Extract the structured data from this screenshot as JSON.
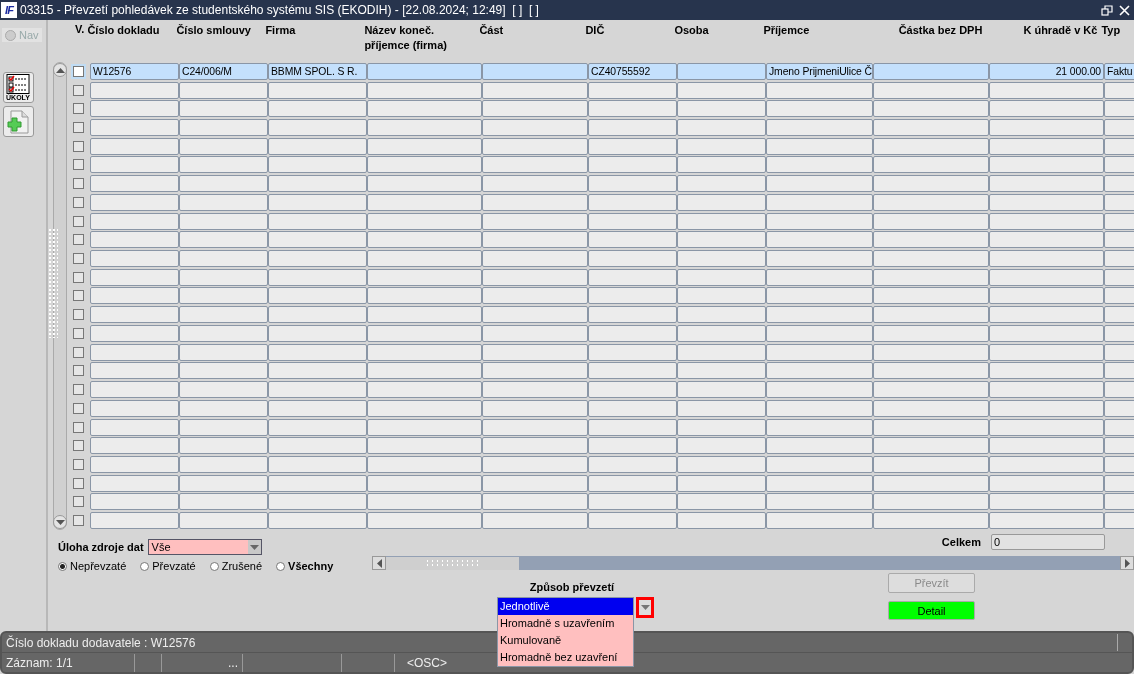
{
  "window": {
    "logo": "IF",
    "title": "03315 - Převzetí pohledávek ze studentského systému SIS (EKODIH) - [22.08.2024; 12:49]  [ ]  [ ]"
  },
  "sidebar": {
    "nav": {
      "label": "Nav",
      "disabled": true
    },
    "tools": [
      {
        "kind": "tasks",
        "label": "ÚKOLY"
      },
      {
        "kind": "add"
      }
    ]
  },
  "table": {
    "check_header": "V.",
    "columns": [
      {
        "label": "Číslo dokladu",
        "kind": "text"
      },
      {
        "label": "Číslo smlouvy",
        "kind": "text"
      },
      {
        "label": "Firma",
        "kind": "text"
      },
      {
        "label": "Název koneč. příjemce (firma)",
        "kind": "text"
      },
      {
        "label": "Část",
        "kind": "text"
      },
      {
        "label": "DIČ",
        "kind": "text"
      },
      {
        "label": "Osoba",
        "kind": "text"
      },
      {
        "label": "Příjemce",
        "kind": "text"
      },
      {
        "label": "Částka bez DPH",
        "kind": "amount"
      },
      {
        "label": "K úhradě v Kč",
        "kind": "amount"
      },
      {
        "label": "Typ",
        "kind": "text"
      }
    ],
    "rows": [
      {
        "selected": true,
        "checked": false,
        "cells": {
          "0": "W12576",
          "1": "C24/006/M",
          "2": "BBMM SPOL. S R.",
          "5": "CZ40755592",
          "7": "Jmeno PrijmeniUlice Č",
          "9": "21 000.00",
          "10": "Faktu"
        }
      },
      {
        "selected": false,
        "checked": false
      },
      {
        "selected": false,
        "checked": false
      },
      {
        "selected": false,
        "checked": false
      },
      {
        "selected": false,
        "checked": false
      },
      {
        "selected": false,
        "checked": false
      },
      {
        "selected": false,
        "checked": false
      },
      {
        "selected": false,
        "checked": false
      },
      {
        "selected": false,
        "checked": false
      },
      {
        "selected": false,
        "checked": false
      },
      {
        "selected": false,
        "checked": false
      },
      {
        "selected": false,
        "checked": false
      },
      {
        "selected": false,
        "checked": false
      },
      {
        "selected": false,
        "checked": false
      },
      {
        "selected": false,
        "checked": false
      },
      {
        "selected": false,
        "checked": false
      },
      {
        "selected": false,
        "checked": false
      },
      {
        "selected": false,
        "checked": false
      },
      {
        "selected": false,
        "checked": false
      },
      {
        "selected": false,
        "checked": false
      },
      {
        "selected": false,
        "checked": false
      },
      {
        "selected": false,
        "checked": false
      },
      {
        "selected": false,
        "checked": false
      },
      {
        "selected": false,
        "checked": false
      },
      {
        "selected": false,
        "checked": false
      }
    ]
  },
  "source": {
    "label": "Úloha zdroje dat",
    "value": "Vše"
  },
  "filter": [
    {
      "label": "Nepřevzaté",
      "selected": true,
      "bold": false
    },
    {
      "label": "Převzaté",
      "selected": false,
      "bold": false
    },
    {
      "label": "Zrušené",
      "selected": false,
      "bold": false
    },
    {
      "label": "Všechny",
      "selected": false,
      "bold": true
    }
  ],
  "total": {
    "label": "Celkem",
    "value": "0"
  },
  "method": {
    "label": "Způsob převzetí",
    "expanded": true,
    "options": [
      {
        "label": "Jednotlivě",
        "selected": true
      },
      {
        "label": "Hromadně s uzavřením",
        "selected": false
      },
      {
        "label": "Kumulovaně",
        "selected": false
      },
      {
        "label": "Hromadně bez uzavření",
        "selected": false
      }
    ]
  },
  "buttons": [
    {
      "label": "Převzít",
      "kind": "plain",
      "disabled": true
    },
    {
      "label": "Detail",
      "kind": "go",
      "disabled": false
    }
  ],
  "status_bar": {
    "message": "Číslo dokladu dodavatele : W12576",
    "record": "Záznam: 1/1",
    "dots": "...",
    "mode": "<OSC>"
  }
}
